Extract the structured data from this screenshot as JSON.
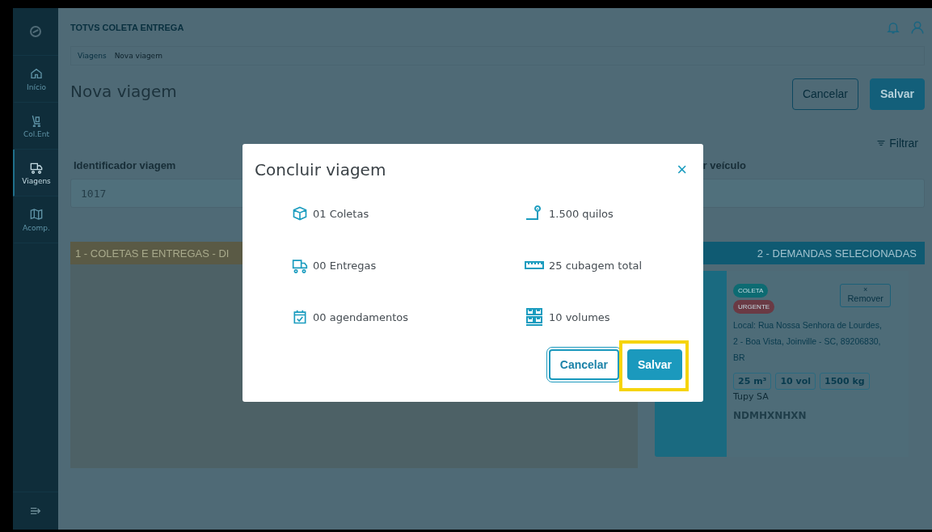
{
  "app": {
    "title": "TOTVS COLETA ENTREGA"
  },
  "sidebar": {
    "items": [
      {
        "kind": "home",
        "label": "Início",
        "selected": false
      },
      {
        "kind": "cart",
        "label": "Col.Ent",
        "selected": false
      },
      {
        "kind": "truck",
        "label": "Viagens",
        "selected": true
      },
      {
        "kind": "map",
        "label": "Acomp.",
        "selected": false
      }
    ]
  },
  "breadcrumb": [
    "Viagens",
    "Nova viagem"
  ],
  "page": {
    "title": "Nova viagem",
    "buttons": [
      {
        "label": "Cancelar",
        "kind": "secondary"
      },
      {
        "label": "Salvar",
        "kind": "primary"
      }
    ],
    "filter": "Filtrar"
  },
  "form": {
    "fields": [
      {
        "label": "Identificador viagem",
        "value": "1017"
      },
      {
        "label": "r veículo"
      }
    ]
  },
  "panels": [
    {
      "title": "1 - COLETAS E ENTREGAS - DI",
      "kind": "available"
    },
    {
      "title": "2 - DEMANDAS SELECIONADAS",
      "kind": "selected"
    }
  ],
  "demand": {
    "tags": [
      {
        "text": "COLETA",
        "color": "#0d6b72"
      },
      {
        "text": "URGENTE",
        "color": "#6a3a44"
      }
    ],
    "remove": {
      "icon": "×",
      "label": "Remover"
    },
    "address": "Local: Rua Nossa Senhora de Lourdes, 2 - Boa Vista, Joinville - SC, 89206830, BR",
    "chips": [
      "25 m³",
      "10 vol",
      "1500 kg"
    ],
    "company": "Tupy SA",
    "code": "NDMHXNHXN"
  },
  "modal": {
    "title": "Concluir viagem",
    "close": "×",
    "stats": [
      {
        "kind": "box",
        "text": "01 Coletas"
      },
      {
        "kind": "scale",
        "text": "1.500 quilos"
      },
      {
        "kind": "truck",
        "text": "00 Entregas"
      },
      {
        "kind": "ruler",
        "text": "25 cubagem total"
      },
      {
        "kind": "calendar",
        "text": "00 agendamentos"
      },
      {
        "kind": "pallet",
        "text": "10 volumes"
      }
    ],
    "buttons": [
      {
        "label": "Cancelar",
        "kind": "secondary"
      },
      {
        "label": "Salvar",
        "kind": "primary",
        "highlighted": true
      }
    ]
  }
}
